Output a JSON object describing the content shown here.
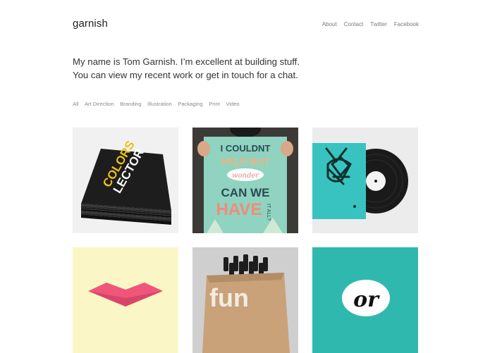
{
  "site": {
    "logo": "garnish"
  },
  "nav": {
    "items": [
      "About",
      "Contact",
      "Twitter",
      "Facebook"
    ]
  },
  "intro": {
    "line1": "My name is Tom Garnish. I’m excellent at building stuff.",
    "line2": "You can view my recent work or get in touch for a chat."
  },
  "filters": {
    "items": [
      "All",
      "Art Direction",
      "Branding",
      "Illustration",
      "Packaging",
      "Print",
      "Video"
    ]
  },
  "portfolio": {
    "items": [
      {
        "name": "colors-lector-books",
        "artwork_text": [
          "COLORS",
          "LECTOR"
        ]
      },
      {
        "name": "poster-couldnt-help",
        "artwork_text": [
          "I COULDNT",
          "HELP BUT",
          "wonder",
          "CAN WE",
          "HAVE",
          "IT ALL?"
        ]
      },
      {
        "name": "vinyl-record",
        "artwork_text": []
      },
      {
        "name": "pink-lips",
        "artwork_text": []
      },
      {
        "name": "bottle-box",
        "artwork_text": [
          "fun"
        ]
      },
      {
        "name": "teal-typography",
        "artwork_text": [
          "or"
        ]
      }
    ]
  },
  "colors": {
    "poster_bg": "#8fd3c0",
    "vinyl_sleeve": "#39c3c0",
    "lips": "#f0567a",
    "teal_tile": "#2fb9ae"
  }
}
